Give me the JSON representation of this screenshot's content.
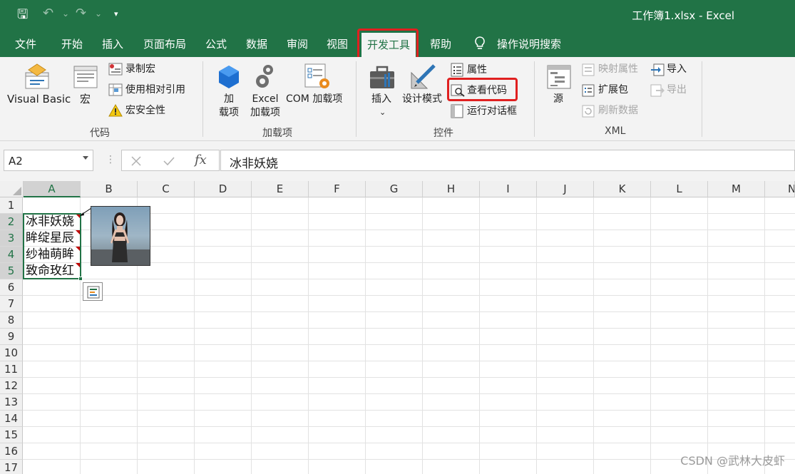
{
  "title": "工作簿1.xlsx  -  Excel",
  "qa": {
    "save": "🖫",
    "undo": "↶",
    "redo": "↷",
    "more": "▾",
    "dd": "⌄"
  },
  "tabs": [
    "文件",
    "开始",
    "插入",
    "页面布局",
    "公式",
    "数据",
    "审阅",
    "视图",
    "开发工具",
    "帮助",
    "操作说明搜索"
  ],
  "ribbon": {
    "code": {
      "label": "代码",
      "vb": "Visual Basic",
      "macro": "宏",
      "record": "录制宏",
      "relative": "使用相对引用",
      "security": "宏安全性"
    },
    "addins": {
      "label": "加载项",
      "addin_l1": "加",
      "addin_l2": "载项",
      "excel_l1": "Excel",
      "excel_l2": "加载项",
      "com": "COM 加载项"
    },
    "controls": {
      "label": "控件",
      "insert": "插入",
      "insert_caret": "⌄",
      "design": "设计模式",
      "props": "属性",
      "viewcode": "查看代码",
      "dialog": "运行对话框"
    },
    "xml": {
      "label": "XML",
      "source": "源",
      "map": "映射属性",
      "expansion": "扩展包",
      "refresh": "刷新数据",
      "import": "导入",
      "export": "导出"
    }
  },
  "namebox": "A2",
  "formula": "冰非妖娆",
  "fx": "fx",
  "columns": [
    "A",
    "B",
    "C",
    "D",
    "E",
    "F",
    "G",
    "H",
    "I",
    "J",
    "K",
    "L",
    "M",
    "N"
  ],
  "rows": [
    "1",
    "2",
    "3",
    "4",
    "5",
    "6",
    "7",
    "8",
    "9",
    "10",
    "11",
    "12",
    "13",
    "14",
    "15",
    "16",
    "17"
  ],
  "cells": [
    "冰非妖娆",
    "眸绽星辰",
    "纱袖萌眸",
    "致命玫红"
  ],
  "watermark": "CSDN @武林大皮虾"
}
